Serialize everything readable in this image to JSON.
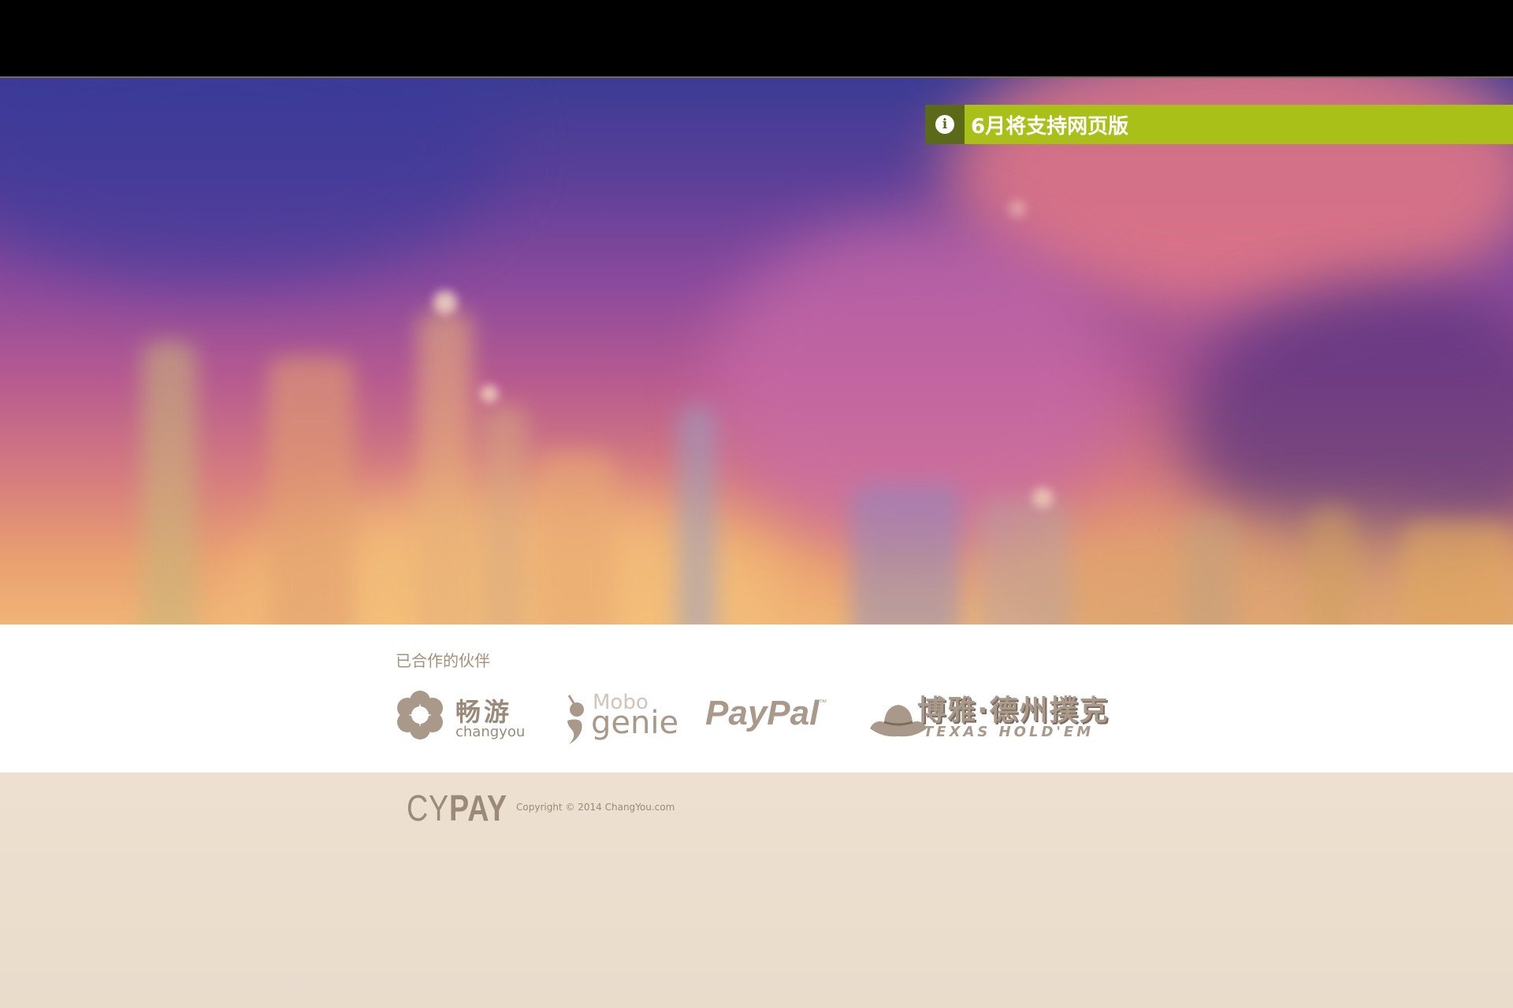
{
  "notice": {
    "text": "6月将支持网页版",
    "icon": "info-icon",
    "bg_color": "#a8c018",
    "icon_bg_color": "#5b6a18"
  },
  "partners": {
    "title": "已合作的伙伴",
    "logos": [
      {
        "name": "changyou",
        "cn": "畅游",
        "en": "changyou"
      },
      {
        "name": "mobogenie",
        "small": "Mobo",
        "main": "genie"
      },
      {
        "name": "paypal",
        "text": "PayPal",
        "tm": "™"
      },
      {
        "name": "texas-holdem",
        "cn": "博雅·德州撲克",
        "en": "TEXAS HOLD'EM"
      }
    ]
  },
  "footer": {
    "brand_light": "CY",
    "brand_bold": "PAY",
    "copyright": "Copyright © 2014 ChangYou.com"
  },
  "colors": {
    "topbar": "#000000",
    "footer_bg": "#eee0d0",
    "logo_tone": "#a8998a"
  }
}
